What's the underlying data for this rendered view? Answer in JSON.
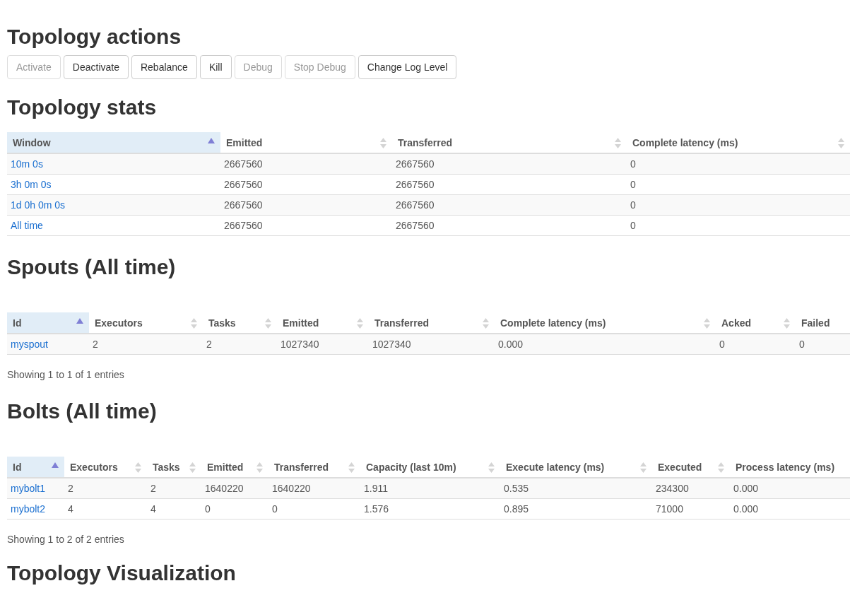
{
  "actions": {
    "title": "Topology actions",
    "buttons": [
      {
        "label": "Activate",
        "disabled": true
      },
      {
        "label": "Deactivate",
        "disabled": false
      },
      {
        "label": "Rebalance",
        "disabled": false
      },
      {
        "label": "Kill",
        "disabled": false
      },
      {
        "label": "Debug",
        "disabled": true
      },
      {
        "label": "Stop Debug",
        "disabled": true
      },
      {
        "label": "Change Log Level",
        "disabled": false
      }
    ]
  },
  "sections": [
    {
      "title": "Topology stats",
      "columns": [
        {
          "label": "Window",
          "selected": true,
          "sortable": true
        },
        {
          "label": "Emitted",
          "selected": false,
          "sortable": true
        },
        {
          "label": "Transferred",
          "selected": false,
          "sortable": true
        },
        {
          "label": "Complete latency (ms)",
          "selected": false,
          "sortable": true
        }
      ],
      "rows": [
        [
          "10m 0s",
          "2667560",
          "2667560",
          "0"
        ],
        [
          "3h 0m 0s",
          "2667560",
          "2667560",
          "0"
        ],
        [
          "1d 0h 0m 0s",
          "2667560",
          "2667560",
          "0"
        ],
        [
          "All time",
          "2667560",
          "2667560",
          "0"
        ]
      ]
    },
    {
      "title": "Spouts (All time)",
      "columns": [
        {
          "label": "Id",
          "selected": true,
          "sortable": true
        },
        {
          "label": "Executors",
          "selected": false,
          "sortable": true
        },
        {
          "label": "Tasks",
          "selected": false,
          "sortable": true
        },
        {
          "label": "Emitted",
          "selected": false,
          "sortable": true
        },
        {
          "label": "Transferred",
          "selected": false,
          "sortable": true
        },
        {
          "label": "Complete latency (ms)",
          "selected": false,
          "sortable": true
        },
        {
          "label": "Acked",
          "selected": false,
          "sortable": true
        },
        {
          "label": "Failed",
          "selected": false,
          "sortable": false
        }
      ],
      "rows": [
        [
          "myspout",
          "2",
          "2",
          "1027340",
          "1027340",
          "0.000",
          "0",
          "0"
        ]
      ],
      "footer": "Showing 1 to 1 of 1 entries"
    },
    {
      "title": "Bolts (All time)",
      "columns": [
        {
          "label": "Id",
          "selected": true,
          "sortable": true
        },
        {
          "label": "Executors",
          "selected": false,
          "sortable": true
        },
        {
          "label": "Tasks",
          "selected": false,
          "sortable": true
        },
        {
          "label": "Emitted",
          "selected": false,
          "sortable": true
        },
        {
          "label": "Transferred",
          "selected": false,
          "sortable": true
        },
        {
          "label": "Capacity (last 10m)",
          "selected": false,
          "sortable": true
        },
        {
          "label": "Execute latency (ms)",
          "selected": false,
          "sortable": true
        },
        {
          "label": "Executed",
          "selected": false,
          "sortable": true
        },
        {
          "label": "Process latency (ms)",
          "selected": false,
          "sortable": false
        }
      ],
      "rows": [
        [
          "mybolt1",
          "2",
          "2",
          "1640220",
          "1640220",
          "1.911",
          "0.535",
          "234300",
          "0.000"
        ],
        [
          "mybolt2",
          "4",
          "4",
          "0",
          "0",
          "1.576",
          "0.895",
          "71000",
          "0.000"
        ]
      ],
      "footer": "Showing 1 to 2 of 2 entries"
    }
  ],
  "next_heading": "Topology Visualization"
}
